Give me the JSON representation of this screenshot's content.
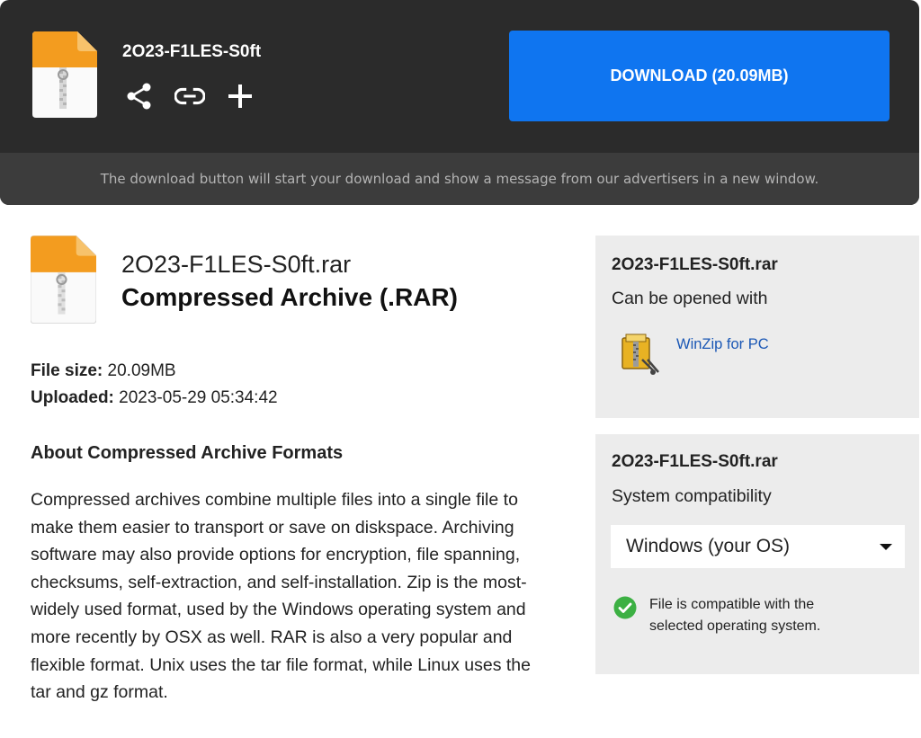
{
  "header": {
    "file_title": "2O23-F1LES-S0ft",
    "download_label": "DOWNLOAD (20.09MB)",
    "notice": "The download button will start your download and show a message from our advertisers in a new window.",
    "actions": [
      "share-icon",
      "link-icon",
      "plus-icon"
    ]
  },
  "file": {
    "name": "2O23-F1LES-S0ft.rar",
    "type": "Compressed Archive (.RAR)",
    "size_label": "File size:",
    "size_value": " 20.09MB",
    "uploaded_label": "Uploaded:",
    "uploaded_value": " 2023-05-29 05:34:42"
  },
  "about": {
    "title": "About Compressed Archive Formats",
    "text": "Compressed archives combine multiple files into a single file to make them easier to transport or save on diskspace. Archiving software may also provide options for encryption, file spanning, checksums, self-extraction, and self-installation. Zip is the most-widely used format, used by the Windows operating system and more recently by OSX as well. RAR is also a very popular and flexible format. Unix uses the tar file format, while Linux uses the tar and gz format."
  },
  "open_panel": {
    "file_name": "2O23-F1LES-S0ft.rar",
    "subtitle": "Can be opened with",
    "app_name": "WinZip for PC",
    "app_icon": "winzip-icon"
  },
  "compat_panel": {
    "file_name": "2O23-F1LES-S0ft.rar",
    "subtitle": "System compatibility",
    "selected_os": "Windows (your OS)",
    "status": "File is compatible with the selected operating system.",
    "status_icon": "check-circle-icon"
  },
  "colors": {
    "header_bg": "#2b2b2b",
    "notice_bg": "#3c3c3c",
    "download_btn": "#0f75f0",
    "panel_bg": "#ececec",
    "link": "#1a57b5",
    "success": "#3cb043",
    "file_icon_orange": "#f39c1f"
  }
}
